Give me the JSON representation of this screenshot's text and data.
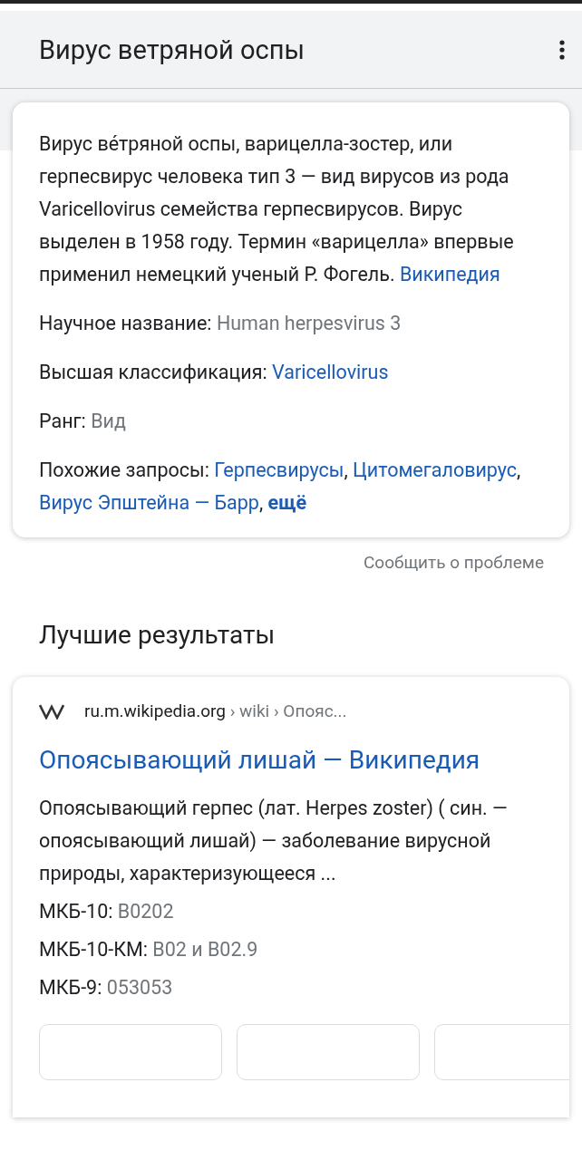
{
  "header": {
    "title": "Вирус ветряной оспы"
  },
  "knowledge_panel": {
    "description": "Вирус ве́тряной оспы, варицелла-зостер, или герпесвирус человека тип 3 — вид вирусов из рода Varicellovirus семейства герпесвирусов. Вирус выделен в 1958 году. Термин «варицелла» впервые применил немецкий ученый Р. Фогель.",
    "source_link": "Википедия",
    "facts": [
      {
        "label": "Научное название:",
        "value": "Human herpesvirus 3",
        "kind": "plain"
      },
      {
        "label": "Высшая классификация:",
        "value": "Varicellovirus",
        "kind": "link"
      },
      {
        "label": "Ранг:",
        "value": "Вид",
        "kind": "plain"
      }
    ],
    "related": {
      "label": "Похожие запросы:",
      "links": [
        "Герпесвирусы",
        "Цитомегаловирус",
        "Вирус Эпштейна — Барр"
      ],
      "separator": ",",
      "more": "ещё"
    }
  },
  "feedback": "Сообщить о проблеме",
  "section_title": "Лучшие результаты",
  "result": {
    "domain": "ru.m.wikipedia.org",
    "breadcrumb": "› wiki › Опояс...",
    "title": "Опоясывающий лишай — Википедия",
    "snippet": "Опоясывающий герпес (лат. Herpes zoster) ( син. — опоясывающий лишай) — заболевание вирусной природы, характеризующееся ...",
    "facts": [
      {
        "label": "МКБ-10:",
        "value": "B0202",
        "kind": "plain"
      },
      {
        "label": "МКБ-10-КМ:",
        "value": "B02 и B02.9",
        "kind": "plain"
      },
      {
        "label": "МКБ-9:",
        "value": "053053",
        "kind": "plain"
      }
    ]
  }
}
